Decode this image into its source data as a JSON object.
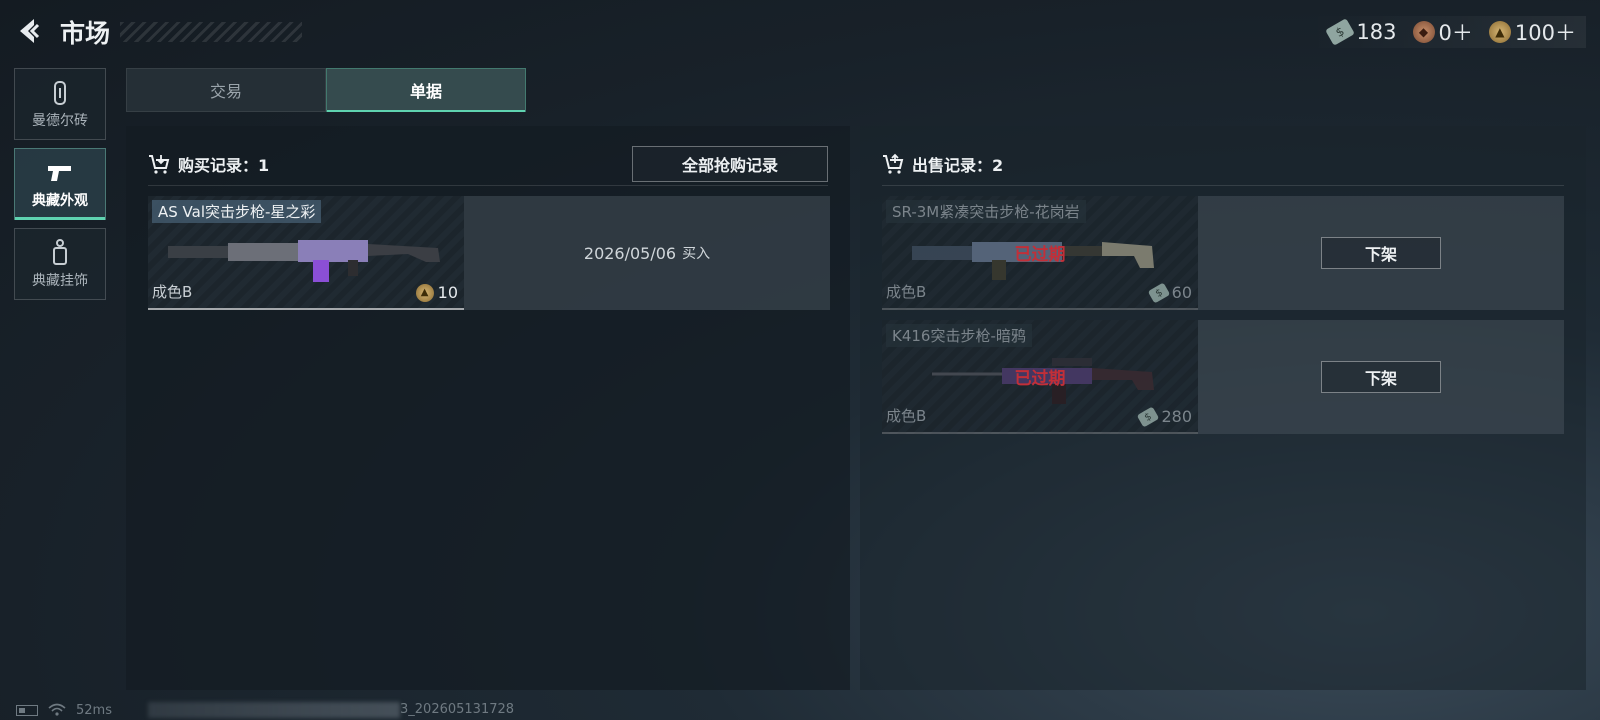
{
  "header": {
    "title": "市场",
    "currencies": [
      {
        "icon": "cash-bill-icon",
        "value": "183"
      },
      {
        "icon": "bronze-token-icon",
        "value": "0＋"
      },
      {
        "icon": "gold-coin-icon",
        "value": "100＋"
      }
    ]
  },
  "sidebar": {
    "items": [
      {
        "label": "曼德尔砖",
        "icon": "mandel-brick-icon",
        "active": false
      },
      {
        "label": "典藏外观",
        "icon": "pistol-icon",
        "active": true
      },
      {
        "label": "典藏挂饰",
        "icon": "charm-tag-icon",
        "active": false
      }
    ]
  },
  "tabs": [
    {
      "label": "交易",
      "active": false
    },
    {
      "label": "单据",
      "active": true
    }
  ],
  "purchase": {
    "title": "购买记录：1",
    "all_button": "全部抢购记录",
    "items": [
      {
        "name": "AS Val突击步枪-星之彩",
        "condition": "成色B",
        "price": "10",
        "price_icon": "gold-coin-icon",
        "date": "2026/05/06",
        "action_text": "买入"
      }
    ]
  },
  "sale": {
    "title": "出售记录：2",
    "items": [
      {
        "name": "SR-3M紧凑突击步枪-花岗岩",
        "condition": "成色B",
        "price": "60",
        "price_icon": "cash-bill-icon",
        "status": "已过期",
        "button": "下架"
      },
      {
        "name": "K416突击步枪-暗鸦",
        "condition": "成色B",
        "price": "280",
        "price_icon": "cash-bill-icon",
        "status": "已过期",
        "button": "下架"
      }
    ]
  },
  "statusbar": {
    "ping": "52ms",
    "build": "3_202605131728"
  },
  "colors": {
    "accent": "#5fd3b0",
    "expired": "#e0313a"
  }
}
